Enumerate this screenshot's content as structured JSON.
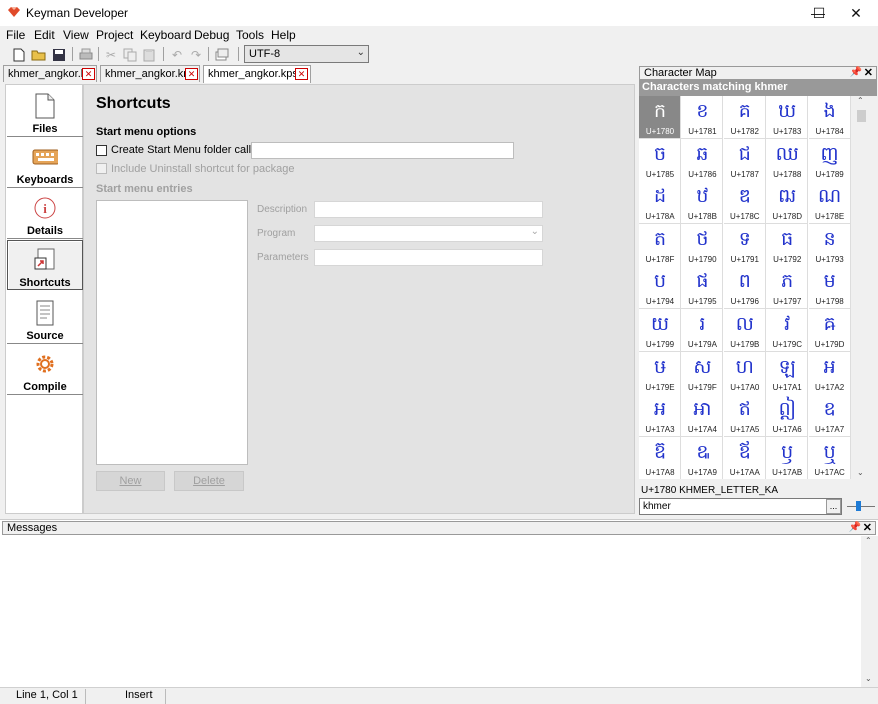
{
  "window": {
    "title": "Keyman Developer",
    "controls": {
      "minimize": "—",
      "maximize": "☐",
      "close": "✕"
    }
  },
  "menu": [
    {
      "label": "File"
    },
    {
      "label": "Edit"
    },
    {
      "label": "View"
    },
    {
      "label": "Project"
    },
    {
      "label": "Keyboard"
    },
    {
      "label": "Debug"
    },
    {
      "label": "Tools"
    },
    {
      "label": "Help"
    }
  ],
  "toolbar": {
    "encoding": "UTF-8",
    "icons": [
      "new-file-icon",
      "open-folder-icon",
      "save-icon",
      "print-icon",
      "cut-icon",
      "copy-icon",
      "paste-icon",
      "undo-icon",
      "redo-icon",
      "window-icon"
    ]
  },
  "tabs": [
    {
      "label": "khmer_angkor.kpj"
    },
    {
      "label": "khmer_angkor.kmn"
    },
    {
      "label": "khmer_angkor.kps *"
    }
  ],
  "sidebar": {
    "items": [
      {
        "label": "Files",
        "icon": "file-icon"
      },
      {
        "label": "Keyboards",
        "icon": "keyboard-icon"
      },
      {
        "label": "Details",
        "icon": "info-icon"
      },
      {
        "label": "Shortcuts",
        "icon": "shortcut-icon",
        "selected": true
      },
      {
        "label": "Source",
        "icon": "source-icon"
      },
      {
        "label": "Compile",
        "icon": "gear-icon"
      }
    ]
  },
  "content": {
    "heading": "Shortcuts",
    "section_label": "Start menu options",
    "create_folder_label": "Create Start Menu folder called:",
    "create_folder_value": "",
    "uninstall_label": "Include Uninstall shortcut for package",
    "entries_label": "Start menu entries",
    "description_label": "Description",
    "program_label": "Program",
    "parameters_label": "Parameters",
    "new_button": "New",
    "delete_button": "Delete"
  },
  "charmap": {
    "panel_title": "Character Map",
    "grid_title": "Characters matching khmer",
    "selected_info": "U+1780 KHMER_LETTER_KA",
    "search_value": "khmer",
    "search_button": "...",
    "chars": [
      {
        "g": "ក",
        "c": "U+1780"
      },
      {
        "g": "ខ",
        "c": "U+1781"
      },
      {
        "g": "គ",
        "c": "U+1782"
      },
      {
        "g": "ឃ",
        "c": "U+1783"
      },
      {
        "g": "ង",
        "c": "U+1784"
      },
      {
        "g": "ច",
        "c": "U+1785"
      },
      {
        "g": "ឆ",
        "c": "U+1786"
      },
      {
        "g": "ជ",
        "c": "U+1787"
      },
      {
        "g": "ឈ",
        "c": "U+1788"
      },
      {
        "g": "ញ",
        "c": "U+1789"
      },
      {
        "g": "ដ",
        "c": "U+178A"
      },
      {
        "g": "ឋ",
        "c": "U+178B"
      },
      {
        "g": "ឌ",
        "c": "U+178C"
      },
      {
        "g": "ឍ",
        "c": "U+178D"
      },
      {
        "g": "ណ",
        "c": "U+178E"
      },
      {
        "g": "ត",
        "c": "U+178F"
      },
      {
        "g": "ថ",
        "c": "U+1790"
      },
      {
        "g": "ទ",
        "c": "U+1791"
      },
      {
        "g": "ធ",
        "c": "U+1792"
      },
      {
        "g": "ន",
        "c": "U+1793"
      },
      {
        "g": "ប",
        "c": "U+1794"
      },
      {
        "g": "ផ",
        "c": "U+1795"
      },
      {
        "g": "ព",
        "c": "U+1796"
      },
      {
        "g": "ភ",
        "c": "U+1797"
      },
      {
        "g": "ម",
        "c": "U+1798"
      },
      {
        "g": "យ",
        "c": "U+1799"
      },
      {
        "g": "រ",
        "c": "U+179A"
      },
      {
        "g": "ល",
        "c": "U+179B"
      },
      {
        "g": "វ",
        "c": "U+179C"
      },
      {
        "g": "ឝ",
        "c": "U+179D"
      },
      {
        "g": "ឞ",
        "c": "U+179E"
      },
      {
        "g": "ស",
        "c": "U+179F"
      },
      {
        "g": "ហ",
        "c": "U+17A0"
      },
      {
        "g": "ឡ",
        "c": "U+17A1"
      },
      {
        "g": "អ",
        "c": "U+17A2"
      },
      {
        "g": "ឣ",
        "c": "U+17A3"
      },
      {
        "g": "ឤ",
        "c": "U+17A4"
      },
      {
        "g": "ឥ",
        "c": "U+17A5"
      },
      {
        "g": "ឦ",
        "c": "U+17A6"
      },
      {
        "g": "ឧ",
        "c": "U+17A7"
      },
      {
        "g": "ឨ",
        "c": "U+17A8"
      },
      {
        "g": "ឩ",
        "c": "U+17A9"
      },
      {
        "g": "ឪ",
        "c": "U+17AA"
      },
      {
        "g": "ឫ",
        "c": "U+17AB"
      },
      {
        "g": "ឬ",
        "c": "U+17AC"
      }
    ]
  },
  "messages": {
    "title": "Messages"
  },
  "statusbar": {
    "position": "Line 1, Col 1",
    "mode": "Insert"
  },
  "colors": {
    "accent": "#2233cc",
    "selected_cell": "#888888"
  }
}
